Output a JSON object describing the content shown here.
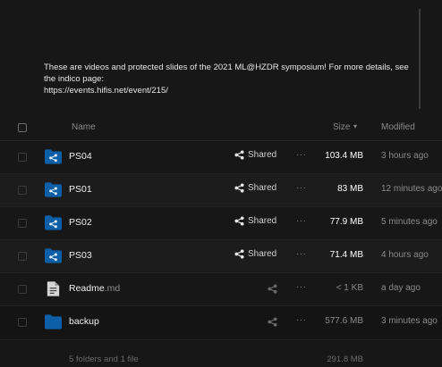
{
  "description": {
    "line1": "These are videos and protected slides of the 2021 ML@HZDR symposium! For more details, see",
    "line2": "the indico page:",
    "line3": "https://events.hifis.net/event/215/"
  },
  "table_header": {
    "name": "Name",
    "size": "Size",
    "sort_indicator": "▾",
    "modified": "Modified"
  },
  "rows": [
    {
      "name": "PS04",
      "ext": "",
      "type": "shared-folder",
      "share_label": "Shared",
      "actions": "···",
      "size": "103.4 MB",
      "modified": "3 hours ago"
    },
    {
      "name": "PS01",
      "ext": "",
      "type": "shared-folder",
      "share_label": "Shared",
      "actions": "···",
      "size": "83 MB",
      "modified": "12 minutes ago"
    },
    {
      "name": "PS02",
      "ext": "",
      "type": "shared-folder",
      "share_label": "Shared",
      "actions": "···",
      "size": "77.9 MB",
      "modified": "5 minutes ago"
    },
    {
      "name": "PS03",
      "ext": "",
      "type": "shared-folder",
      "share_label": "Shared",
      "actions": "···",
      "size": "71.4 MB",
      "modified": "4 hours ago"
    },
    {
      "name": "Readme",
      "ext": ".md",
      "type": "document",
      "share_label": "",
      "actions": "···",
      "size": "< 1 KB",
      "modified": "a day ago"
    },
    {
      "name": "backup",
      "ext": "",
      "type": "folder",
      "share_label": "",
      "actions": "···",
      "size": "577.6 MB",
      "modified": "3 minutes ago"
    }
  ],
  "footer": {
    "count": "5 folders and 1 file",
    "total": "291.8 MB"
  },
  "colors": {
    "background": "#171717",
    "folder": "#0d5fa8",
    "text": "#f0f0f0",
    "muted": "#8a8a8a"
  }
}
